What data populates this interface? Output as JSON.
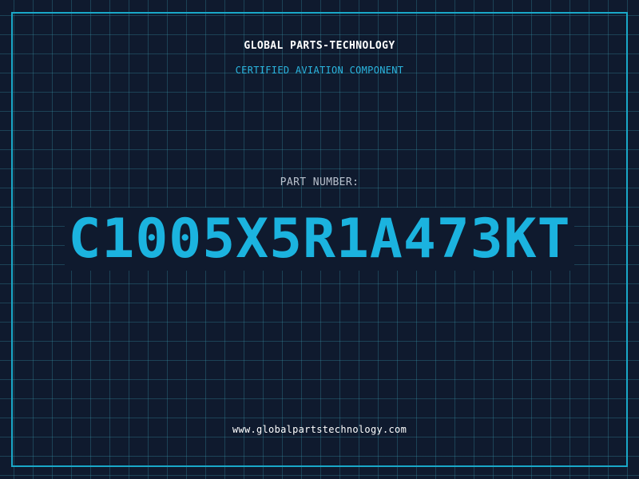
{
  "header": {
    "company": "GLOBAL PARTS-TECHNOLOGY",
    "tagline": "CERTIFIED AVIATION COMPONENT"
  },
  "main": {
    "label": "PART NUMBER:",
    "part_number": "C1005X5R1A473KT"
  },
  "footer": {
    "website": "www.globalpartstechnology.com"
  },
  "colors": {
    "background": "#0f1a2e",
    "accent": "#1bb3df",
    "grid": "#3a96aa",
    "text": "#ffffff"
  }
}
